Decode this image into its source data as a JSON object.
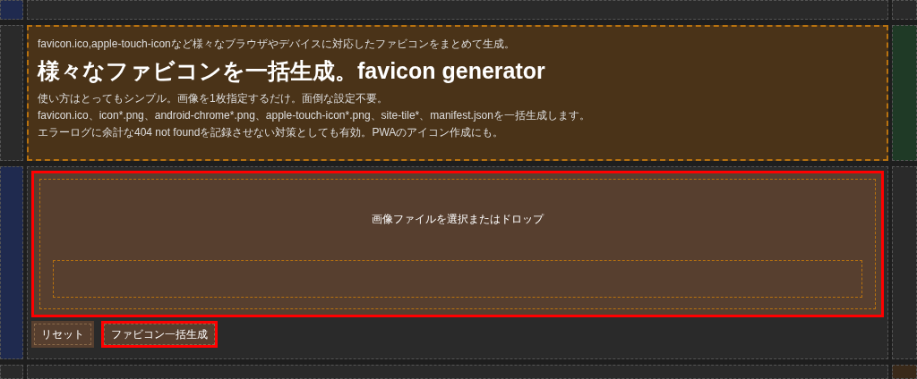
{
  "header": {
    "tagline": "favicon.ico,apple-touch-iconなど様々なブラウザやデバイスに対応したファビコンをまとめて生成。",
    "title": "様々なファビコンを一括生成。favicon generator",
    "description": [
      "使い方はとってもシンプル。画像を1枚指定するだけ。面倒な設定不要。",
      "favicon.ico、icon*.png、android-chrome*.png、apple-touch-icon*.png、site-tile*、manifest.jsonを一括生成します。",
      "エラーログに余計な404 not foundを記録させない対策としても有効。PWAのアイコン作成にも。"
    ]
  },
  "dropzone": {
    "label": "画像ファイルを選択またはドロップ",
    "highlighted": true
  },
  "buttons": [
    {
      "label": "リセット",
      "highlighted": false
    },
    {
      "label": "ファビコン一括生成",
      "highlighted": true
    }
  ]
}
